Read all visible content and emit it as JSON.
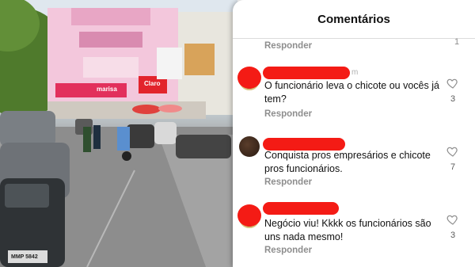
{
  "photo": {
    "signs": {
      "store": "marisa",
      "brand": "Claro"
    },
    "plate": "MMP 5842"
  },
  "sheet": {
    "title": "Comentários",
    "top_reply": "Responder",
    "top_count": "1"
  },
  "comments": [
    {
      "name_suffix": "m",
      "text": "O funcionário leva o chicote ou vocês já tem?",
      "reply": "Responder",
      "likes": "3"
    },
    {
      "name_suffix": "",
      "text": "Conquista pros empresários e chicote pros funcionários.",
      "reply": "Responder",
      "likes": "7"
    },
    {
      "name_suffix": "",
      "text": "Negócio viu! Kkkk os funcionários são uns nada mesmo!",
      "reply": "Responder",
      "likes": "3"
    }
  ],
  "colors": {
    "censor": "#f41b15",
    "muted": "#8e8e8e",
    "text": "#111111"
  }
}
